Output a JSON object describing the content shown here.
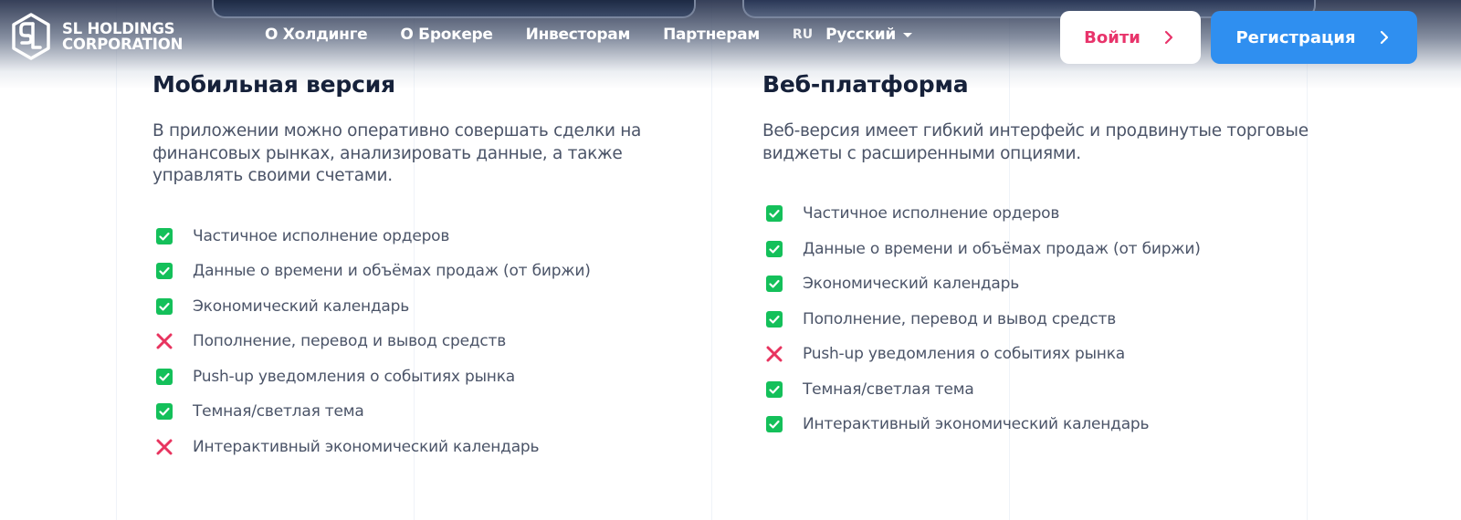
{
  "header": {
    "logo_line1": "SL HOLDINGS",
    "logo_line2": "CORPORATION",
    "nav": [
      {
        "label": "О Холдинге"
      },
      {
        "label": "О Брокере"
      },
      {
        "label": "Инвесторам"
      },
      {
        "label": "Партнерам"
      }
    ],
    "lang_code": "RU",
    "lang_name": "Русский",
    "login_label": "Войти",
    "register_label": "Регистрация"
  },
  "colors": {
    "accent_blue": "#2f8ff0",
    "accent_pink": "#e8346b",
    "check_green": "#14c05a",
    "cross_red": "#e8345f",
    "heading": "#16213a",
    "body_text": "#4b5468"
  },
  "mobile": {
    "title": "Мобильная версия",
    "description": "В приложении можно оперативно совершать сделки на финансовых рынках, анализировать данные, а также управлять своими счетами.",
    "features": [
      {
        "label": "Частичное исполнение ордеров",
        "available": true,
        "icon": "check-icon"
      },
      {
        "label": "Данные о времени и объёмах продаж (от биржи)",
        "available": true,
        "icon": "check-icon"
      },
      {
        "label": "Экономический календарь",
        "available": true,
        "icon": "check-icon"
      },
      {
        "label": "Пополнение, перевод и вывод средств",
        "available": false,
        "icon": "cross-icon"
      },
      {
        "label": "Push-up уведомления о событиях рынка",
        "available": true,
        "icon": "check-icon"
      },
      {
        "label": "Темная/светлая тема",
        "available": true,
        "icon": "check-icon"
      },
      {
        "label": "Интерактивный экономический календарь",
        "available": false,
        "icon": "cross-icon"
      }
    ]
  },
  "web": {
    "title": "Веб-платформа",
    "description": "Веб-версия имеет гибкий интерфейс и продвинутые торговые виджеты с расширенными опциями.",
    "features": [
      {
        "label": "Частичное исполнение ордеров",
        "available": true,
        "icon": "check-icon"
      },
      {
        "label": "Данные о времени и объёмах продаж (от биржи)",
        "available": true,
        "icon": "check-icon"
      },
      {
        "label": "Экономический календарь",
        "available": true,
        "icon": "check-icon"
      },
      {
        "label": "Пополнение, перевод и вывод средств",
        "available": true,
        "icon": "check-icon"
      },
      {
        "label": "Push-up уведомления о событиях рынка",
        "available": false,
        "icon": "cross-icon"
      },
      {
        "label": "Темная/светлая тема",
        "available": true,
        "icon": "check-icon"
      },
      {
        "label": "Интерактивный экономический календарь",
        "available": true,
        "icon": "check-icon"
      }
    ]
  }
}
